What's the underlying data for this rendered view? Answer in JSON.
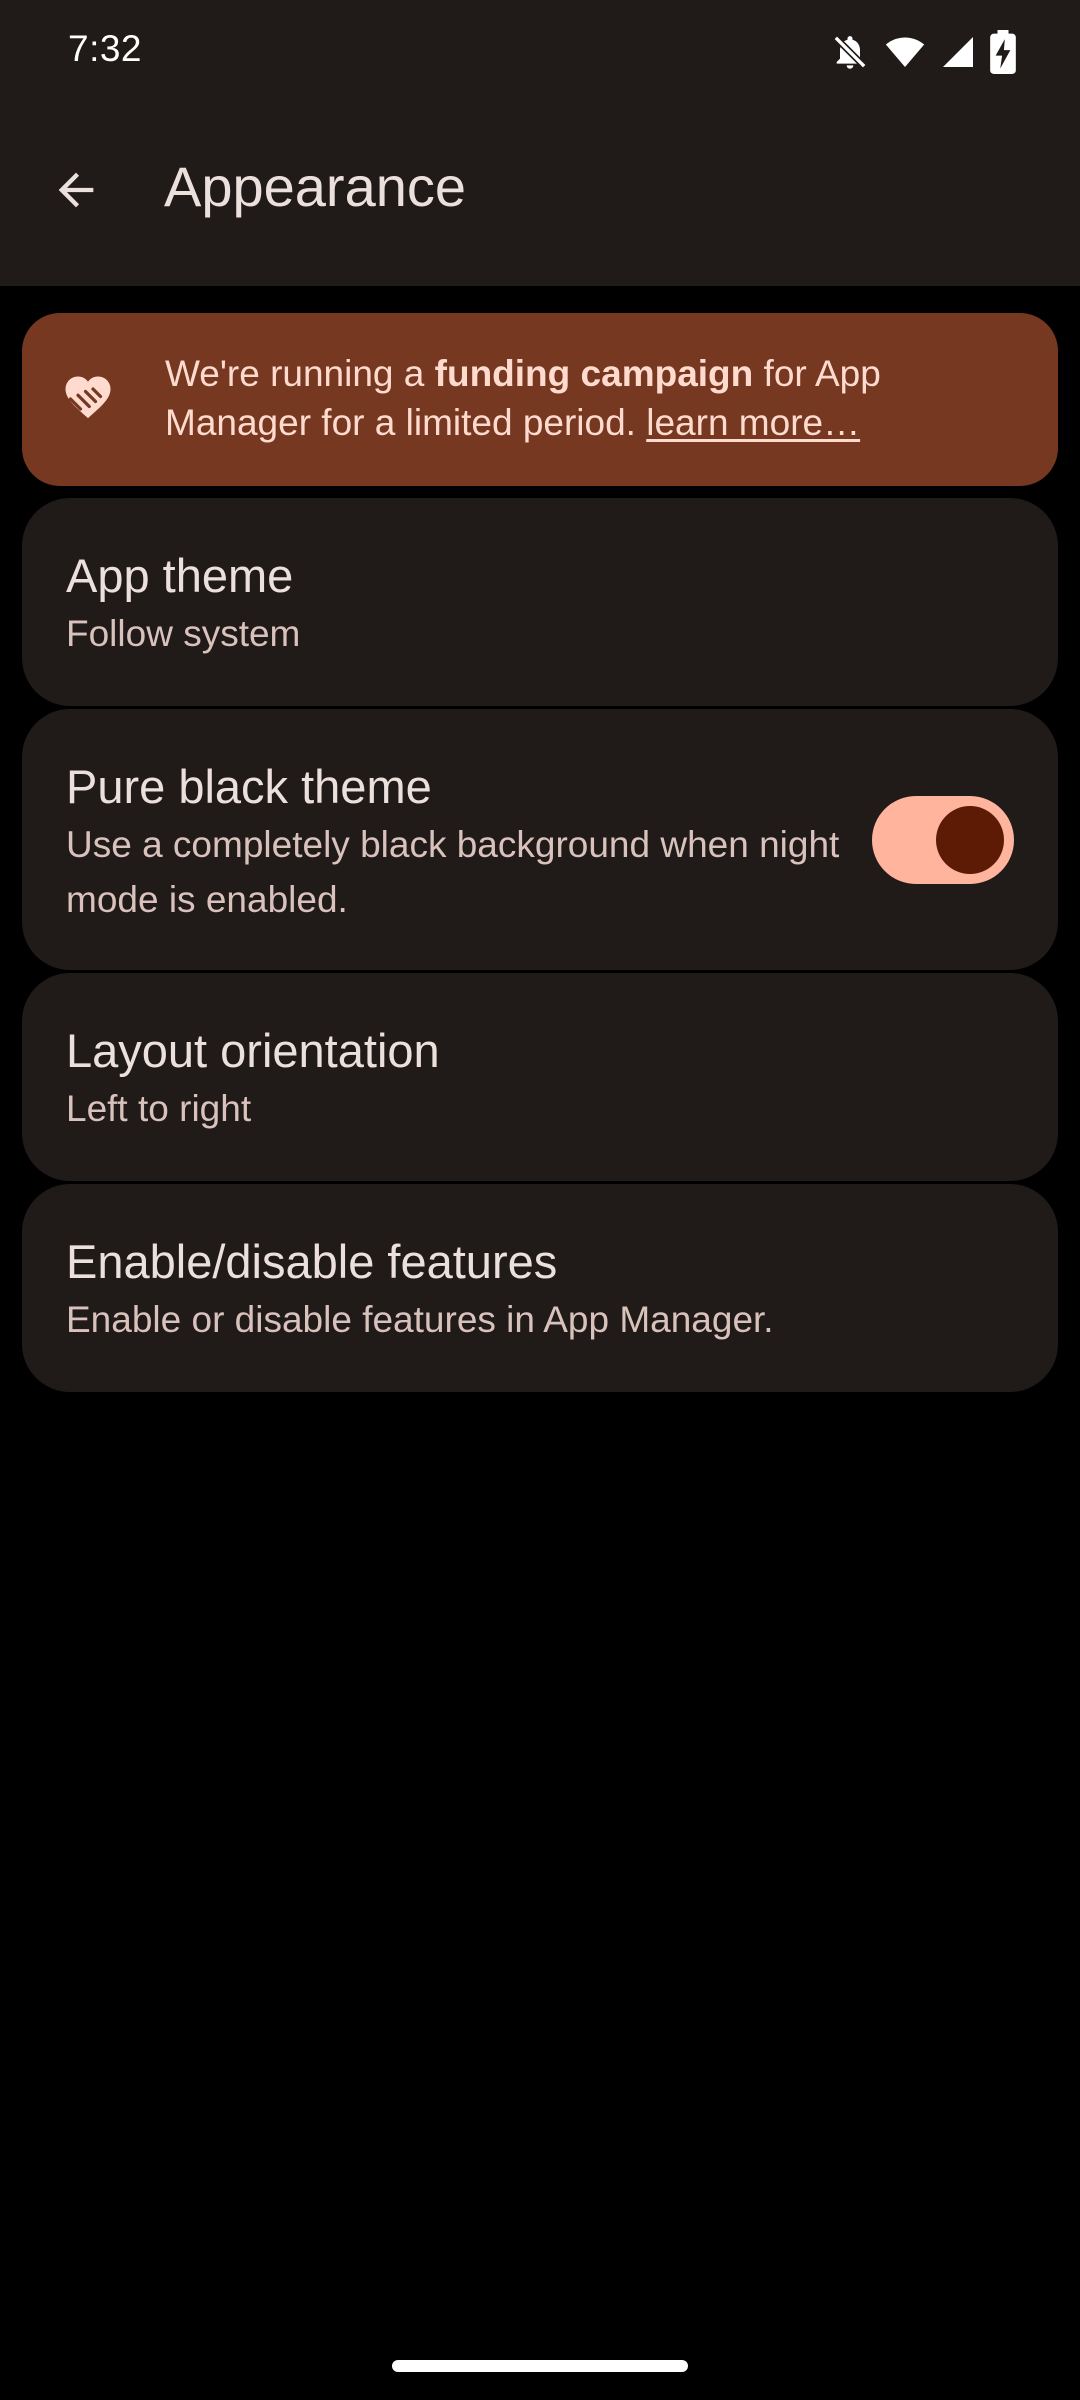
{
  "status_bar": {
    "time": "7:32",
    "icons": [
      "notifications-off-icon",
      "wifi-icon",
      "cellular-signal-icon",
      "battery-charging-icon"
    ]
  },
  "app_bar": {
    "back_icon": "arrow-back-icon",
    "title": "Appearance"
  },
  "banner": {
    "icon": "volunteer-handshake-icon",
    "text_before": "We're running a ",
    "text_bold": "funding campaign",
    "text_after": " for App Manager for a limited period. ",
    "link": "learn more…"
  },
  "settings": [
    {
      "title": "App theme",
      "summary": "Follow system"
    },
    {
      "title": "Pure black theme",
      "summary": "Use a completely black background when night mode is enabled.",
      "toggle_on": true
    },
    {
      "title": "Layout orientation",
      "summary": "Left to right"
    },
    {
      "title": "Enable/disable features",
      "summary": "Enable or disable features in App Manager."
    }
  ],
  "colors": {
    "background": "#000000",
    "surface": "#201a19",
    "banner": "#763820",
    "banner_text": "#ffdbcf",
    "accent": "#ffb59d",
    "accent_dark": "#5d1a05"
  }
}
